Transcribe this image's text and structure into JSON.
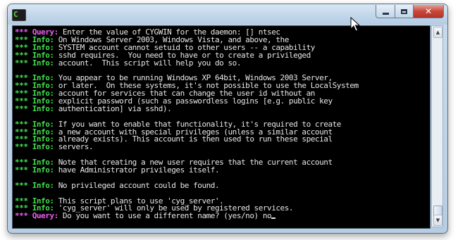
{
  "window": {
    "title": "",
    "buttons": {
      "minimize": "minimize",
      "maximize": "maximize",
      "close": "✕"
    }
  },
  "app_icon": {
    "glyph": "C"
  },
  "console": {
    "lines": [
      {
        "tag": "Query:",
        "type": "query",
        "text": " Enter the value of CYGWIN for the daemon: [] ntsec"
      },
      {
        "tag": "Info:",
        "type": "info",
        "text": " On Windows Server 2003, Windows Vista, and above, the"
      },
      {
        "tag": "Info:",
        "type": "info",
        "text": " SYSTEM account cannot setuid to other users -- a capability"
      },
      {
        "tag": "Info:",
        "type": "info",
        "text": " sshd requires.  You need to have or to create a privileged"
      },
      {
        "tag": "Info:",
        "type": "info",
        "text": " account.  This script will help you do so."
      },
      {
        "tag": "",
        "type": "blank",
        "text": ""
      },
      {
        "tag": "Info:",
        "type": "info",
        "text": " You appear to be running Windows XP 64bit, Windows 2003 Server,"
      },
      {
        "tag": "Info:",
        "type": "info",
        "text": " or later.  On these systems, it's not possible to use the LocalSystem"
      },
      {
        "tag": "Info:",
        "type": "info",
        "text": " account for services that can change the user id without an"
      },
      {
        "tag": "Info:",
        "type": "info",
        "text": " explicit password (such as passwordless logins [e.g. public key"
      },
      {
        "tag": "Info:",
        "type": "info",
        "text": " authentication] via sshd)."
      },
      {
        "tag": "",
        "type": "blank",
        "text": ""
      },
      {
        "tag": "Info:",
        "type": "info",
        "text": " If you want to enable that functionality, it's required to create"
      },
      {
        "tag": "Info:",
        "type": "info",
        "text": " a new account with special privileges (unless a similar account"
      },
      {
        "tag": "Info:",
        "type": "info",
        "text": " already exists). This account is then used to run these special"
      },
      {
        "tag": "Info:",
        "type": "info",
        "text": " servers."
      },
      {
        "tag": "",
        "type": "blank",
        "text": ""
      },
      {
        "tag": "Info:",
        "type": "info",
        "text": " Note that creating a new user requires that the current account"
      },
      {
        "tag": "Info:",
        "type": "info",
        "text": " have Administrator privileges itself."
      },
      {
        "tag": "",
        "type": "blank",
        "text": ""
      },
      {
        "tag": "Info:",
        "type": "info",
        "text": " No privileged account could be found."
      },
      {
        "tag": "",
        "type": "blank",
        "text": ""
      },
      {
        "tag": "Info:",
        "type": "info",
        "text": " This script plans to use 'cyg_server'."
      },
      {
        "tag": "Info:",
        "type": "info",
        "text": " 'cyg_server' will only be used by registered services."
      },
      {
        "tag": "Query:",
        "type": "query",
        "text": " Do you want to use a different name? (yes/no) no"
      }
    ],
    "prefix": "***",
    "colors": {
      "info": "#3fe04a",
      "query": "#f05cf0",
      "text": "#e8e8e8",
      "background": "#000000"
    }
  }
}
